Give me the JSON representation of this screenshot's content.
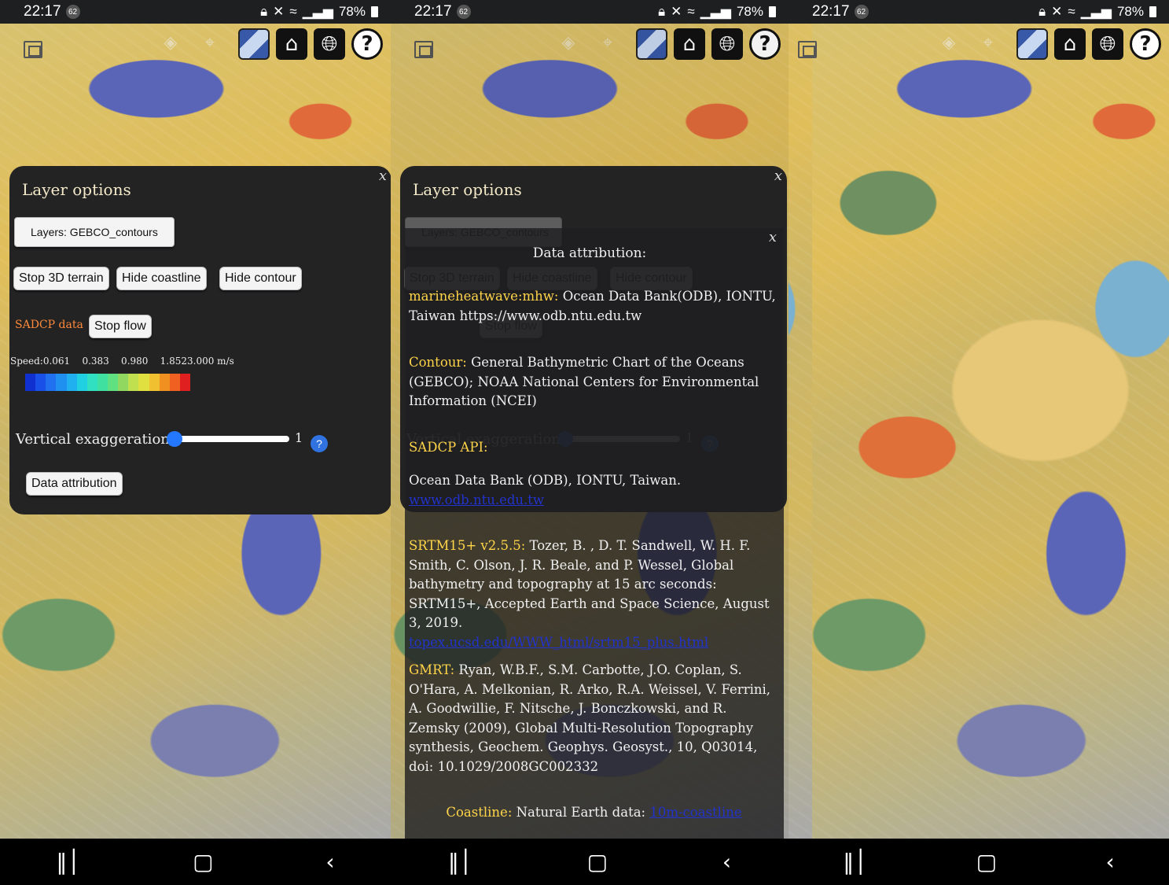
{
  "status": {
    "time": "22:17",
    "badge": "62",
    "battery": "78%"
  },
  "toolbar_icons": [
    "fullscreen-icon",
    "layers-icon",
    "map-pin-icon",
    "basemap-icon",
    "home-icon",
    "globe-icon",
    "help-icon"
  ],
  "panel": {
    "title": "Layer options",
    "close": "x",
    "layers_button": "Layers: GEBCO_contours",
    "stop_terrain": "Stop 3D terrain",
    "hide_coastline": "Hide coastline",
    "hide_contour": "Hide contour",
    "sadcp_label": "SADCP data",
    "stop_flow": "Stop flow",
    "speed_legend": "Speed:0.061    0.383    0.980    1.8523.000 m/s",
    "vertical_label": "Vertical exaggeration",
    "vertical_value": "1",
    "vertical_level": 1,
    "help": "?",
    "data_attribution": "Data attribution"
  },
  "attribution": {
    "title": "Data attribution:",
    "close": "x",
    "mhw_key": "marineheatwave:mhw:",
    "mhw_text": " Ocean Data Bank(ODB), IONTU, Taiwan https://www.odb.ntu.edu.tw",
    "contour_key": "Contour:",
    "contour_text": " General Bathymetric Chart of the Oceans (GEBCO); NOAA National Centers for Environmental Information (NCEI)",
    "sadcp_key": "SADCP API:",
    "sadcp_text": "Ocean Data Bank (ODB), IONTU, Taiwan.",
    "sadcp_link": "www.odb.ntu.edu.tw",
    "srtm_key": "SRTM15+ v2.5.5:",
    "srtm_text": " Tozer, B. , D. T. Sandwell, W. H. F. Smith, C. Olson, J. R. Beale, and P. Wessel, Global bathymetry and topography at 15 arc seconds: SRTM15+, Accepted Earth and Space Science, August 3, 2019.",
    "srtm_link": "topex.ucsd.edu/WWW_html/srtm15_plus.html",
    "gmrt_key": "GMRT:",
    "gmrt_text": " Ryan, W.B.F., S.M. Carbotte, J.O. Coplan, S. O'Hara, A. Melkonian, R. Arko, R.A. Weissel, V. Ferrini, A. Goodwillie, F. Nitsche, J. Bonczkowski, and R. Zemsky (2009), Global Multi-Resolution Topography synthesis, Geochem. Geophys. Geosyst., 10, Q03014, doi: 10.1029/2008GC002332",
    "coast_key": "Coastline:",
    "coast_text": " Natural Earth data: ",
    "coast_link": "10m-coastline"
  },
  "colors": {
    "accent": "#2478ff",
    "key": "#ffd54a",
    "sadcp": "#ff8a3a",
    "colorbar": [
      "#1030d0",
      "#1850e8",
      "#2070f0",
      "#2090f0",
      "#20b0f0",
      "#20d0e0",
      "#30e0c0",
      "#40e0a0",
      "#60e080",
      "#90d860",
      "#c0e050",
      "#e0e040",
      "#f0c030",
      "#f09020",
      "#f06020",
      "#e02020"
    ]
  }
}
